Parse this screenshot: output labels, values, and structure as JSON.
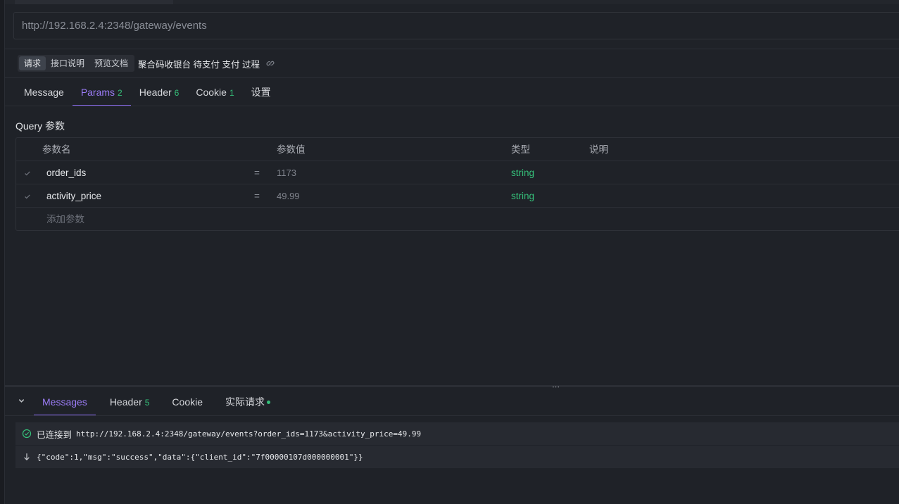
{
  "url": {
    "value": "http://192.168.2.4:2348/gateway/events"
  },
  "doc_tabs": [
    "请求",
    "接口说明",
    "预览文档"
  ],
  "doc_title": "聚合码收银台 待支付 支付 过程",
  "request_tabs": [
    {
      "label": "Message",
      "badge": ""
    },
    {
      "label": "Params",
      "badge": "2"
    },
    {
      "label": "Header",
      "badge": "6"
    },
    {
      "label": "Cookie",
      "badge": "1"
    },
    {
      "label": "设置",
      "badge": ""
    }
  ],
  "query_section": {
    "title": "Query 参数",
    "headers": {
      "name": "参数名",
      "value": "参数值",
      "type": "类型",
      "desc": "说明"
    },
    "rows": [
      {
        "name": "order_ids",
        "eq": "=",
        "value": "1173",
        "type": "string"
      },
      {
        "name": "activity_price",
        "eq": "=",
        "value": "49.99",
        "type": "string"
      }
    ],
    "add_label": "添加参数"
  },
  "splitter_grip": "⋯",
  "response_tabs": [
    {
      "label": "Messages",
      "badge": ""
    },
    {
      "label": "Header",
      "badge": "5"
    },
    {
      "label": "Cookie",
      "badge": ""
    },
    {
      "label": "实际请求",
      "badge": ""
    }
  ],
  "messages": [
    {
      "kind": "connected",
      "label": "已连接到",
      "text": "http://192.168.2.4:2348/gateway/events?order_ids=1173&activity_price=49.99"
    },
    {
      "kind": "received",
      "label": "",
      "text": "{\"code\":1,\"msg\":\"success\",\"data\":{\"client_id\":\"7f00000107d000000001\"}}"
    }
  ],
  "colors": {
    "accent": "#8b6cf0",
    "success": "#35c07a",
    "background": "#1f2228"
  }
}
